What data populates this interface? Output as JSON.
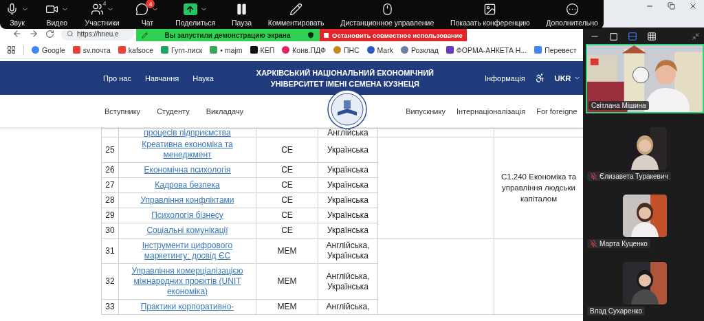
{
  "meeting_toolbar": {
    "items": [
      {
        "kind": "mic",
        "label": "Звук",
        "caret": true
      },
      {
        "kind": "video",
        "label": "Видео",
        "caret": true
      },
      {
        "kind": "participants",
        "label": "Участники",
        "caret": true,
        "count": "4"
      },
      {
        "kind": "chat",
        "label": "Чат",
        "caret": true,
        "badge": "4"
      },
      {
        "kind": "share",
        "label": "Поделиться",
        "caret": true
      },
      {
        "kind": "pause",
        "label": "Пауза",
        "caret": false
      },
      {
        "kind": "annotate",
        "label": "Комментировать",
        "caret": false
      },
      {
        "kind": "remote",
        "label": "Дистанционное управление",
        "caret": false
      },
      {
        "kind": "view",
        "label": "Показать конференцию",
        "caret": false
      },
      {
        "kind": "more",
        "label": "Дополнительно",
        "caret": false
      }
    ]
  },
  "share_banner": {
    "status": "Вы запустили демонстрацию экрана",
    "stop": "Остановить совместное использование"
  },
  "browser": {
    "url": "https://hneu.e",
    "bookmarks": [
      {
        "kind": "google",
        "label": "Google"
      },
      {
        "kind": "gmail",
        "label": "sv.почта"
      },
      {
        "kind": "gmail",
        "label": "kafsoce"
      },
      {
        "kind": "drive",
        "label": "Гугл-лиск"
      },
      {
        "kind": "mail",
        "label": "• majm"
      },
      {
        "kind": "app",
        "label": "КЕП"
      },
      {
        "kind": "heart",
        "label": "Конв.ПДФ"
      },
      {
        "kind": "cap",
        "label": "ПНС"
      },
      {
        "kind": "mark",
        "label": "Mark"
      },
      {
        "kind": "clock",
        "label": "Розклад"
      },
      {
        "kind": "form",
        "label": "ФОРМА-АНКЕТА Н..."
      },
      {
        "kind": "translate",
        "label": "Перевест"
      }
    ]
  },
  "site": {
    "nav_left": [
      "Про нас",
      "Навчання",
      "Наука"
    ],
    "title_lines": [
      "ХАРКІВСЬКИЙ НАЦІОНАЛЬНИЙ ЕКОНОМІЧНИЙ",
      "УНІВЕРСИТЕТ ІМЕНІ СЕМЕНА КУЗНЕЦЯ"
    ],
    "info": "Інформація",
    "language": "UKR",
    "sub_nav_left": [
      "Вступнику",
      "Студенту",
      "Викладачу"
    ],
    "sub_nav_right": [
      "Випускнику",
      "Інтернаціоналізація",
      "For foreigne"
    ]
  },
  "table": {
    "groups": [
      {
        "rows": [
          {
            "name": "процесів підприємства",
            "language": "Англійська"
          }
        ]
      },
      {
        "specialty_lines": [
          "C1.240 Економіка та",
          "управління людськи",
          "капіталом"
        ],
        "rows": [
          {
            "number": "25",
            "name": "Креативна економіка та менеджмент",
            "type": "СЕ",
            "language": "Українська"
          },
          {
            "number": "26",
            "name": "Економічна психологія",
            "type": "СЕ",
            "language": "Українська"
          },
          {
            "number": "27",
            "name": "Кадрова безпека",
            "type": "СЕ",
            "language": "Українська"
          },
          {
            "number": "28",
            "name": "Управління конфліктами",
            "type": "СЕ",
            "language": "Українська"
          },
          {
            "number": "29",
            "name": "Психологія бізнесу",
            "type": "СЕ",
            "language": "Українська"
          },
          {
            "number": "30",
            "name": "Соціальні комунікації",
            "type": "СЕ",
            "language": "Українська"
          }
        ]
      },
      {
        "rows": [
          {
            "number": "31",
            "name": "Інструменти цифрового маркетингу: досвід ЄС",
            "type": "МЕМ",
            "language": "Англійська, Українська"
          },
          {
            "number": "32",
            "name": "Управління комерціалізацією міжнародних проєктів (UNIT економіка)",
            "type": "МЕМ",
            "language": "Англійська, Українська"
          },
          {
            "number": "33",
            "name": "Практики корпоративно-",
            "type": "МЕМ",
            "language": "Англійська,"
          }
        ]
      }
    ]
  },
  "gallery": {
    "view_modes": [
      {
        "kind": "minimize",
        "selected": false
      },
      {
        "kind": "single",
        "selected": false
      },
      {
        "kind": "strip",
        "selected": true
      },
      {
        "kind": "grid",
        "selected": false
      }
    ],
    "participants": [
      {
        "name": "Світлана Мішина",
        "active": true,
        "muted": false
      },
      {
        "name": "Єлизавета Туракевич",
        "active": false,
        "muted": true
      },
      {
        "name": "Марта Куценко",
        "active": false,
        "muted": true
      },
      {
        "name": "Влад Сухаренко",
        "active": false,
        "muted": false
      }
    ]
  }
}
